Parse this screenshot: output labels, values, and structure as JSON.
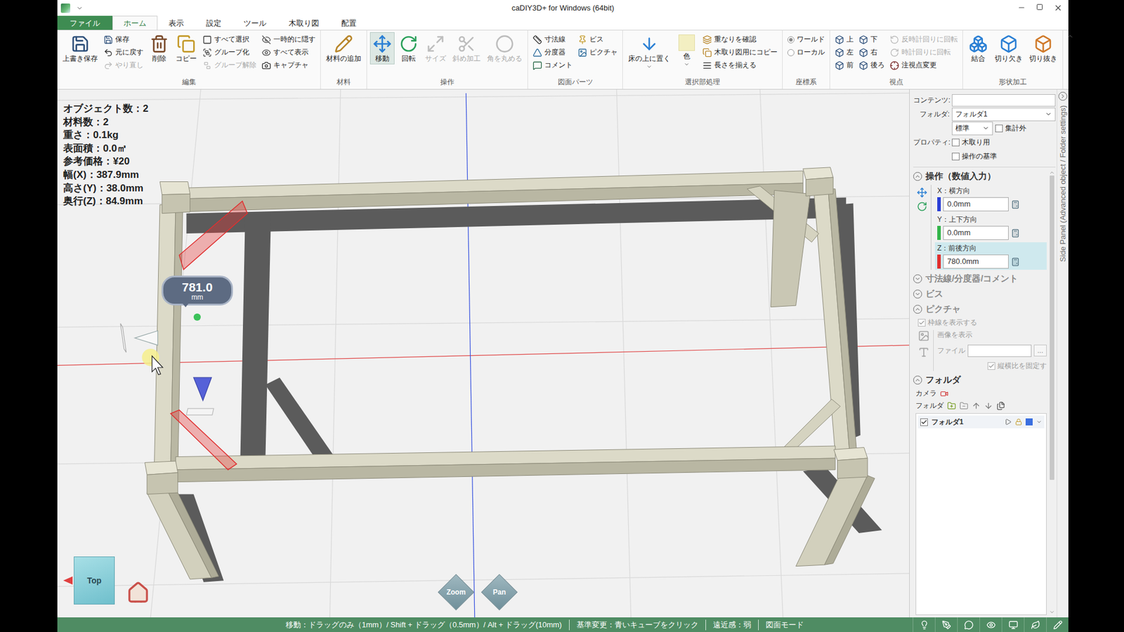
{
  "window": {
    "title": "caDIY3D+ for Windows (64bit)"
  },
  "tabs": [
    {
      "label": "ファイル",
      "selected": false,
      "kind": "file"
    },
    {
      "label": "ホーム",
      "selected": true,
      "kind": "tab"
    },
    {
      "label": "表示",
      "selected": false,
      "kind": "tab"
    },
    {
      "label": "設定",
      "selected": false,
      "kind": "tab"
    },
    {
      "label": "ツール",
      "selected": false,
      "kind": "tab"
    },
    {
      "label": "木取り図",
      "selected": false,
      "kind": "tab"
    },
    {
      "label": "配置",
      "selected": false,
      "kind": "tab"
    }
  ],
  "ribbon": [
    {
      "label": "編集",
      "items": [
        {
          "kind": "large",
          "label": "上書き保存",
          "disabled": false,
          "selected": false,
          "menu": false
        },
        {
          "kind": "stack",
          "buttons": [
            {
              "kind": "button",
              "label": "保存",
              "disabled": false,
              "selected": false
            },
            {
              "kind": "button",
              "label": "元に戻す",
              "disabled": false,
              "selected": false
            },
            {
              "kind": "button",
              "label": "やり直し",
              "disabled": true,
              "selected": false
            }
          ]
        },
        {
          "kind": "large",
          "label": "削除",
          "disabled": false,
          "selected": false,
          "menu": false
        },
        {
          "kind": "large",
          "label": "コピー",
          "disabled": false,
          "selected": false,
          "menu": false
        },
        {
          "kind": "stack",
          "buttons": [
            {
              "kind": "button",
              "label": "すべて選択",
              "disabled": false,
              "selected": false
            },
            {
              "kind": "button",
              "label": "グループ化",
              "disabled": false,
              "selected": false
            },
            {
              "kind": "button",
              "label": "グループ解除",
              "disabled": true,
              "selected": false
            }
          ]
        },
        {
          "kind": "stack",
          "buttons": [
            {
              "kind": "button",
              "label": "一時的に隠す",
              "disabled": false,
              "selected": false
            },
            {
              "kind": "button",
              "label": "すべて表示",
              "disabled": false,
              "selected": false
            },
            {
              "kind": "button",
              "label": "キャプチャ",
              "disabled": false,
              "selected": false
            }
          ]
        }
      ]
    },
    {
      "label": "材料",
      "items": [
        {
          "kind": "large",
          "label": "材料の追加",
          "disabled": false,
          "selected": false,
          "menu": false
        }
      ]
    },
    {
      "label": "操作",
      "items": [
        {
          "kind": "large",
          "label": "移動",
          "disabled": false,
          "selected": true,
          "menu": false
        },
        {
          "kind": "large",
          "label": "回転",
          "disabled": false,
          "selected": false,
          "menu": false
        },
        {
          "kind": "large",
          "label": "サイズ",
          "disabled": true,
          "selected": false,
          "menu": false
        },
        {
          "kind": "large",
          "label": "斜め加工",
          "disabled": true,
          "selected": false,
          "menu": false
        },
        {
          "kind": "large",
          "label": "角を丸める",
          "disabled": true,
          "selected": false,
          "menu": false
        }
      ]
    },
    {
      "label": "図面パーツ",
      "items": [
        {
          "kind": "stack",
          "buttons": [
            {
              "kind": "button",
              "label": "寸法線",
              "disabled": false,
              "selected": false
            },
            {
              "kind": "button",
              "label": "分度器",
              "disabled": false,
              "selected": false
            },
            {
              "kind": "button",
              "label": "コメント",
              "disabled": false,
              "selected": false
            }
          ]
        },
        {
          "kind": "stack",
          "buttons": [
            {
              "kind": "button",
              "label": "ビス",
              "disabled": false,
              "selected": false
            },
            {
              "kind": "button",
              "label": "ピクチャ",
              "disabled": false,
              "selected": false
            }
          ]
        }
      ]
    },
    {
      "label": "選択部処理",
      "items": [
        {
          "kind": "large",
          "label": "床の上に置く",
          "disabled": false,
          "selected": false,
          "menu": true
        },
        {
          "kind": "swatch",
          "label": "色",
          "disabled": false,
          "selected": false,
          "menu": true
        },
        {
          "kind": "stack",
          "buttons": [
            {
              "kind": "button",
              "label": "重なりを確認",
              "disabled": false,
              "selected": false
            },
            {
              "kind": "button",
              "label": "木取り図用にコピー",
              "disabled": false,
              "selected": false
            },
            {
              "kind": "button",
              "label": "長さを揃える",
              "disabled": false,
              "selected": false
            }
          ]
        }
      ]
    },
    {
      "label": "座標系",
      "items": [
        {
          "kind": "stack",
          "buttons": [
            {
              "kind": "radio",
              "label": "ワールド",
              "disabled": false,
              "selected": true
            },
            {
              "kind": "radio",
              "label": "ローカル",
              "disabled": false,
              "selected": false
            }
          ]
        }
      ]
    },
    {
      "label": "視点",
      "items": [
        {
          "kind": "stack",
          "buttons": [
            {
              "kind": "button",
              "label": "上",
              "disabled": false,
              "selected": false
            },
            {
              "kind": "button",
              "label": "左",
              "disabled": false,
              "selected": false
            },
            {
              "kind": "button",
              "label": "前",
              "disabled": false,
              "selected": false
            }
          ]
        },
        {
          "kind": "stack",
          "buttons": [
            {
              "kind": "button",
              "label": "下",
              "disabled": false,
              "selected": false
            },
            {
              "kind": "button",
              "label": "右",
              "disabled": false,
              "selected": false
            },
            {
              "kind": "button",
              "label": "後ろ",
              "disabled": false,
              "selected": false
            }
          ]
        },
        {
          "kind": "stack",
          "buttons": [
            {
              "kind": "button",
              "label": "反時計回りに回転",
              "disabled": true,
              "selected": false
            },
            {
              "kind": "button",
              "label": "時計回りに回転",
              "disabled": true,
              "selected": false
            },
            {
              "kind": "button",
              "label": "注視点変更",
              "disabled": false,
              "selected": false
            }
          ]
        }
      ]
    },
    {
      "label": "形状加工",
      "items": [
        {
          "kind": "large",
          "label": "結合",
          "disabled": false,
          "selected": false,
          "menu": false
        },
        {
          "kind": "large",
          "label": "切り欠き",
          "disabled": false,
          "selected": false,
          "menu": false
        },
        {
          "kind": "large",
          "label": "切り抜き",
          "disabled": false,
          "selected": false,
          "menu": false
        }
      ]
    }
  ],
  "viewport": {
    "info": [
      "オブジェクト数：2",
      "材料数：2",
      "重さ：0.1kg",
      "表面積：0.0㎡",
      "参考価格：¥20",
      "幅(X)：387.9mm",
      "高さ(Y)：38.0mm",
      "奥行(Z)：84.9mm"
    ],
    "badge": {
      "value": "781.0",
      "unit": "mm"
    },
    "view_cube": "Top",
    "nav": [
      {
        "label": "Zoom"
      },
      {
        "label": "Pan"
      }
    ]
  },
  "side_panel": {
    "vertical_label": "Side Panel (Advanced object / Folder settings)",
    "contents_label": "コンテンツ:",
    "contents_value": "",
    "folder_label": "フォルダ:",
    "folder_value": "フォルダ1",
    "standard_value": "標準",
    "exclude": {
      "label": "集計外",
      "checked": false
    },
    "property_label": "プロパティ:",
    "properties": [
      {
        "label": "木取り用",
        "checked": false
      },
      {
        "label": "操作の基準",
        "checked": false
      }
    ],
    "operation": {
      "title": "操作（数値入力）",
      "expanded": true,
      "fields": [
        {
          "label": "X：横方向",
          "value": "0.0mm",
          "color": "#2b3fd6",
          "selected": false
        },
        {
          "label": "Y：上下方向",
          "value": "0.0mm",
          "color": "#33b54a",
          "selected": false
        },
        {
          "label": "Z：前後方向",
          "value": "780.0mm",
          "color": "#e0302f",
          "selected": true
        }
      ]
    },
    "collapsed_sections": [
      {
        "title": "寸法線/分度器/コメント",
        "expanded": false
      },
      {
        "title": "ビス",
        "expanded": false
      }
    ],
    "picture": {
      "title": "ピクチャ",
      "expanded": true,
      "disabled": true,
      "frame": {
        "label": "枠線を表示する",
        "checked": true
      },
      "show_image": "画像を表示",
      "file_label": "ファイル",
      "file_value": "",
      "file_button": "...",
      "aspect": {
        "label": "縦横比を固定す",
        "checked": true
      }
    },
    "folder": {
      "title": "フォルダ",
      "expanded": true,
      "camera_label": "カメラ",
      "folder_label": "フォルダ",
      "rows": [
        {
          "label": "フォルダ1",
          "checked": true,
          "color": "#3b6fe0"
        }
      ]
    }
  },
  "status_bar": {
    "hints": [
      "移動：ドラッグのみ（1mm）/ Shift + ドラッグ（0.5mm）/ Alt + ドラッグ(10mm)",
      "基準変更：青いキューブをクリック",
      "遠近感：弱",
      "図面モード"
    ]
  }
}
